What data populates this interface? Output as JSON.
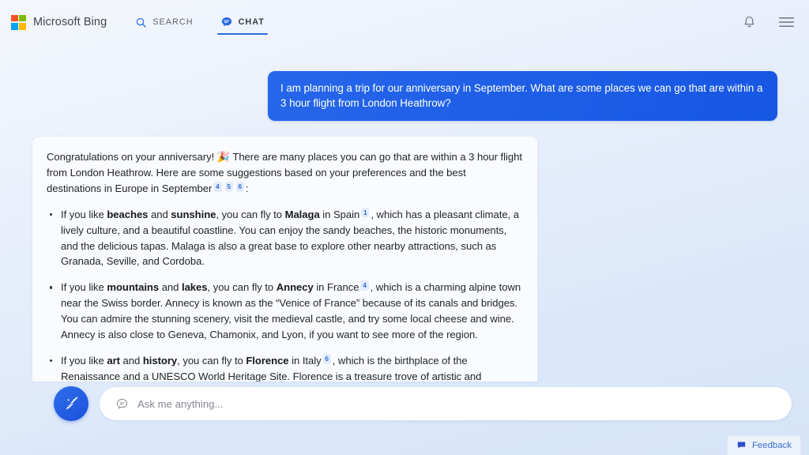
{
  "header": {
    "brand": "Microsoft Bing",
    "logo_colors": {
      "top_left": "#f25022",
      "top_right": "#7fba00",
      "bottom_left": "#00a4ef",
      "bottom_right": "#ffb900"
    },
    "tabs": [
      {
        "label": "SEARCH",
        "icon": "search-icon",
        "active": false
      },
      {
        "label": "CHAT",
        "icon": "chat-bubble-icon",
        "active": true
      }
    ],
    "active_tab_indicator_color": "#2b6be0",
    "right_icons": [
      {
        "name": "notification-bell-icon"
      },
      {
        "name": "hamburger-menu-icon"
      }
    ]
  },
  "conversation": {
    "user_message": "I am planning a trip for our anniversary in September. What are some places we can go that are within a 3 hour flight from London Heathrow?",
    "user_bubble_color": "#1b5fe8",
    "bot_intro": {
      "before": "Congratulations on your anniversary! 🎉 There are many places you can go that are within a 3 hour flight from London Heathrow. Here are some suggestions based on your preferences and the best destinations in Europe in September",
      "citations": [
        "4",
        "5",
        "6"
      ],
      "after": ":"
    },
    "bot_items": [
      {
        "lead": "If you like ",
        "bold1": "beaches",
        "mid1": " and ",
        "bold2": "sunshine",
        "mid2": ", you can fly to ",
        "place": "Malaga",
        "country": " in Spain",
        "citation": "1",
        "rest": ", which has a pleasant climate, a lively culture, and a beautiful coastline. You can enjoy the sandy beaches, the historic monuments, and the delicious tapas. Malaga is also a great base to explore other nearby attractions, such as Granada, Seville, and Cordoba."
      },
      {
        "lead": "If you like ",
        "bold1": "mountains",
        "mid1": " and ",
        "bold2": "lakes",
        "mid2": ", you can fly to ",
        "place": "Annecy",
        "country": " in France",
        "citation": "4",
        "rest": ", which is a charming alpine town near the Swiss border. Annecy is known as the “Venice of France” because of its canals and bridges. You can admire the stunning scenery, visit the medieval castle, and try some local cheese and wine. Annecy is also close to Geneva, Chamonix, and Lyon, if you want to see more of the region."
      },
      {
        "lead": "If you like ",
        "bold1": "art",
        "mid1": " and ",
        "bold2": "history",
        "mid2": ", you can fly to ",
        "place": "Florence",
        "country": " in Italy",
        "citation": "6",
        "rest": ", which is the birthplace of the Renaissance and a UNESCO World Heritage Site. Florence is a treasure trove of artistic and architectural masterpieces, such as the Duomo, the Uffizi Gallery, and the Ponte Vecchio. You can also explore the Tuscan countryside, taste the famous gelato, and shop for leather goods."
      }
    ]
  },
  "composer": {
    "sweep_button_icon": "broom-sweep-icon",
    "input_icon": "chat-bubble-icon",
    "placeholder": "Ask me anything..."
  },
  "feedback": {
    "label": "Feedback",
    "icon": "feedback-bubble-icon",
    "color": "#3a6fd4"
  }
}
